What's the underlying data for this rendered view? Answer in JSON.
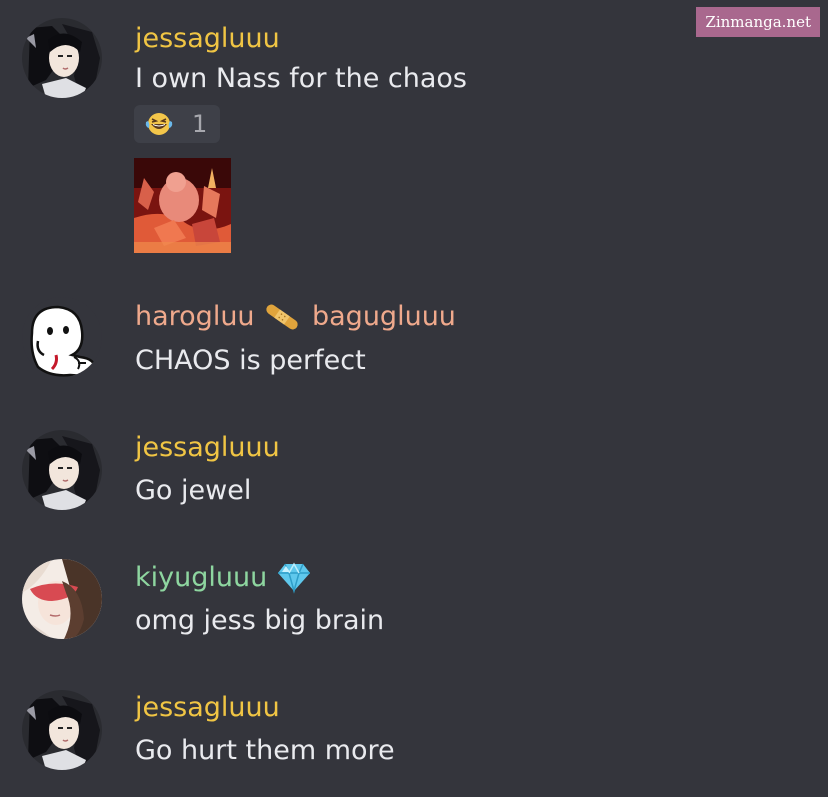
{
  "watermark": "Zinmanga.net",
  "messages": [
    {
      "username": "jessagluuu",
      "text": "I own Nass for the chaos",
      "reaction": {
        "emoji": "laughing-with-tears",
        "count": "1"
      },
      "attachment": "image"
    },
    {
      "username": "harogluu",
      "role_icon": "bandaid-icon",
      "username_suffix": "bagugluuu",
      "text": "CHAOS is perfect"
    },
    {
      "username": "jessagluuu",
      "text": "Go jewel"
    },
    {
      "username": "kiyugluuu",
      "role_icon": "diamond-icon",
      "text": "omg jess big brain"
    },
    {
      "username": "jessagluuu",
      "text": "Go hurt them more"
    }
  ],
  "colors": {
    "background": "#34353c",
    "username_yellow": "#f0c544",
    "username_peach": "#efa98c",
    "username_green": "#8ed6a0",
    "message_text": "#e9eaee"
  }
}
